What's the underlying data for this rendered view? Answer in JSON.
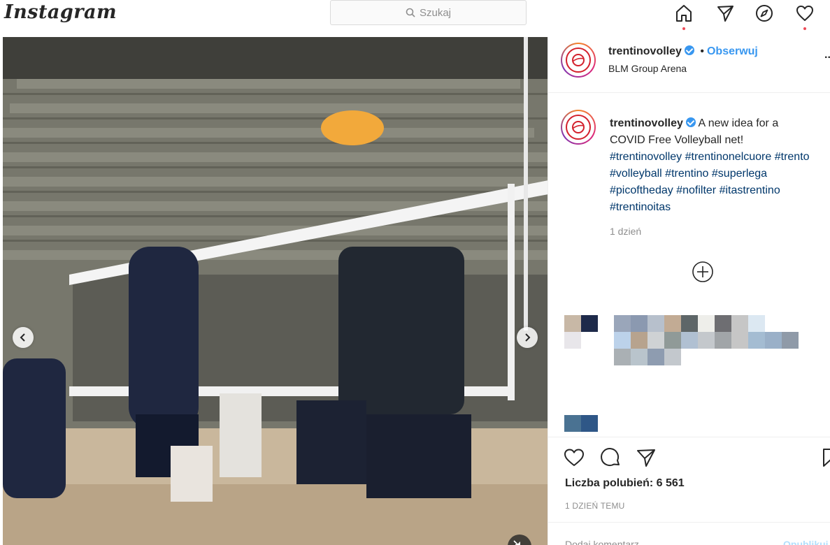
{
  "header": {
    "logo": "Instagram",
    "search_placeholder": "Szukaj",
    "nav_icons": [
      "home-icon",
      "direct-icon",
      "explore-icon",
      "activity-heart-icon"
    ]
  },
  "post": {
    "author": "trentinovolley",
    "follow_label": "Obserwuj",
    "separator": "•",
    "location": "BLM Group Arena",
    "more": "...",
    "caption_text": "A new idea for a COVID Free Volleyball net!",
    "hashtags": [
      "#trentinovolley",
      "#trentinonelcuore",
      "#trento",
      "#volleyball",
      "#trentino",
      "#superlega",
      "#picoftheday",
      "#nofilter",
      "#itastrentino",
      "#trentinoitas"
    ],
    "time": "1 dzień",
    "likes_text": "Liczba polubień: 6 561",
    "posted_ago": "1 DZIEŃ TEMU",
    "add_comment_placeholder": "Dodaj komentarz...",
    "publish_label": "Opublikuj"
  },
  "colors": {
    "accent_blue": "#3897f0",
    "notification_red": "#ed4956",
    "brand_red": "#d3212d",
    "hashtag": "#00376b"
  }
}
